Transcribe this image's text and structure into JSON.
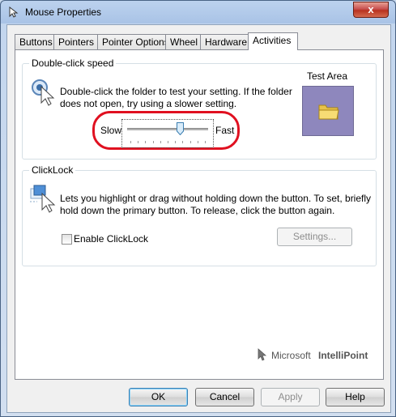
{
  "window": {
    "title": "Mouse Properties",
    "close_label": "x"
  },
  "tabs": [
    {
      "label": "Buttons"
    },
    {
      "label": "Pointers"
    },
    {
      "label": "Pointer Options"
    },
    {
      "label": "Wheel"
    },
    {
      "label": "Hardware"
    },
    {
      "label": "Activities"
    }
  ],
  "active_tab": "Activities",
  "double_click": {
    "group_label": "Double-click speed",
    "description_line1": "Double-click the folder to test your setting. If the folder",
    "description_line2": "does not open, try using a slower setting.",
    "test_area_label": "Test Area",
    "slow_label": "Slow",
    "fast_label": "Fast",
    "speed_fraction": 0.67
  },
  "clicklock": {
    "group_label": "ClickLock",
    "description_line1": "Lets you highlight or drag without holding down the button. To set, briefly",
    "description_line2": "hold down the primary button. To release, click the button again.",
    "enable_label": "Enable ClickLock",
    "enabled": false,
    "settings_label": "Settings..."
  },
  "brand": {
    "prefix": "Microsoft",
    "product": "IntelliPoint"
  },
  "buttons": {
    "ok": "OK",
    "cancel": "Cancel",
    "apply": "Apply",
    "help": "Help"
  }
}
